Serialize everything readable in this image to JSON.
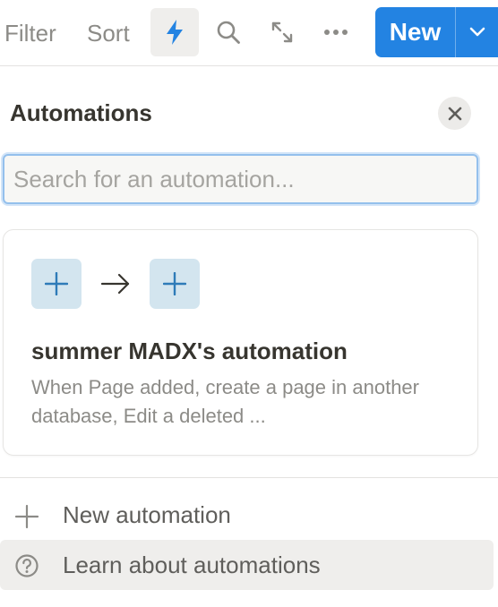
{
  "toolbar": {
    "filter_label": "Filter",
    "sort_label": "Sort",
    "new_label": "New",
    "icons": [
      "lightning-icon",
      "search-icon",
      "expand-icon",
      "more-icon",
      "chevron-down-icon"
    ],
    "accent_color": "#2383e2"
  },
  "panel": {
    "title": "Automations",
    "search": {
      "placeholder": "Search for an automation...",
      "value": ""
    },
    "automations": [
      {
        "name": "summer MADX's automation",
        "description": "When Page added, create a page in another database, Edit a deleted ..."
      }
    ],
    "actions": {
      "new_label": "New automation",
      "learn_label": "Learn about automations"
    }
  }
}
